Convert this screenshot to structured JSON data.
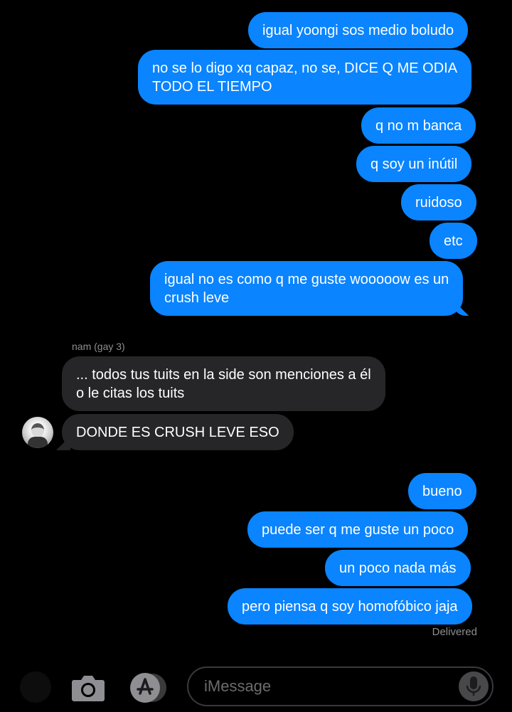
{
  "conversation": {
    "messages_top": [
      {
        "text": "igual yoongi sos medio boludo"
      },
      {
        "text": "no se lo digo xq capaz, no se, DICE Q ME ODIA\nTODO EL TIEMPO"
      },
      {
        "text": "q no m banca"
      },
      {
        "text": "q soy un inútil"
      },
      {
        "text": "ruidoso"
      },
      {
        "text": "etc"
      },
      {
        "text": "igual no es como q me guste wooooow es un\ncrush leve"
      }
    ],
    "sender_name": "nam (gay 3)",
    "incoming": [
      {
        "text": "... todos tus tuits en la side son menciones a él\no le citas los tuits"
      },
      {
        "text": "DONDE ES CRUSH LEVE ESO"
      }
    ],
    "messages_bottom": [
      {
        "text": "bueno"
      },
      {
        "text": "puede ser q me guste un poco"
      },
      {
        "text": "un poco nada más"
      },
      {
        "text": "pero piensa q soy homofóbico jaja"
      }
    ],
    "delivery_status": "Delivered"
  },
  "composer": {
    "placeholder": "iMessage"
  },
  "colors": {
    "outgoing_bubble": "#0a84ff",
    "incoming_bubble": "#262629",
    "background": "#000000"
  },
  "icons": [
    "camera-icon",
    "app-store-icon",
    "microphone-icon"
  ]
}
